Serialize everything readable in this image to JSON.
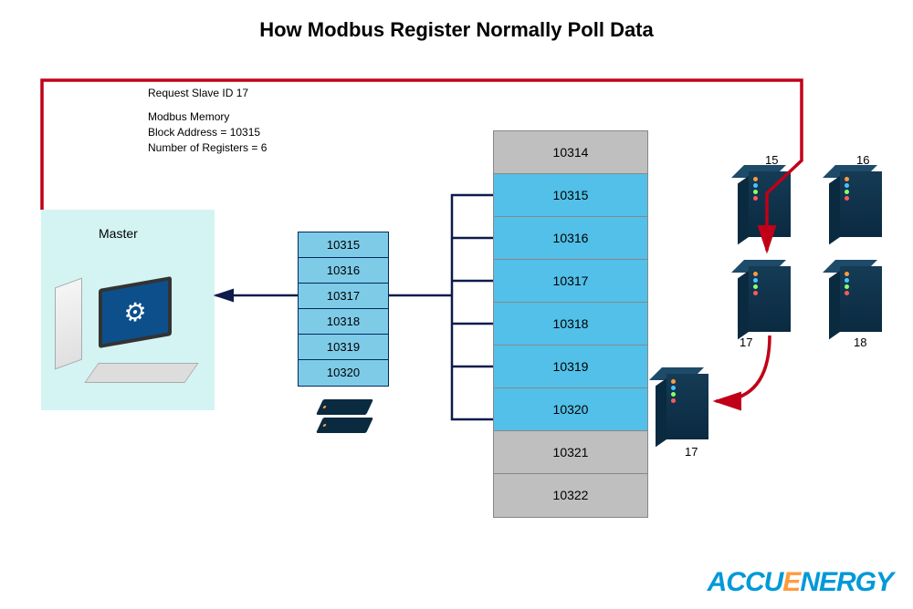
{
  "title": "How Modbus Register Normally Poll Data",
  "request_label": "Request Slave ID 17",
  "memory": {
    "line1": "Modbus Memory",
    "line2": "Block Address = 10315",
    "line3": "Number of Registers = 6"
  },
  "master_label": "Master",
  "small_registers": [
    "10315",
    "10316",
    "10317",
    "10318",
    "10319",
    "10320"
  ],
  "big_registers": [
    {
      "value": "10314",
      "class": "gray"
    },
    {
      "value": "10315",
      "class": "blue"
    },
    {
      "value": "10316",
      "class": "blue"
    },
    {
      "value": "10317",
      "class": "blue"
    },
    {
      "value": "10318",
      "class": "blue"
    },
    {
      "value": "10319",
      "class": "blue"
    },
    {
      "value": "10320",
      "class": "blue"
    },
    {
      "value": "10321",
      "class": "gray"
    },
    {
      "value": "10322",
      "class": "gray"
    }
  ],
  "servers": {
    "s15": "15",
    "s16": "16",
    "s17": "17",
    "s18": "18",
    "s17b": "17"
  },
  "brand": {
    "part1": "ACCU",
    "part2": "E",
    "part3": "NERGY"
  }
}
